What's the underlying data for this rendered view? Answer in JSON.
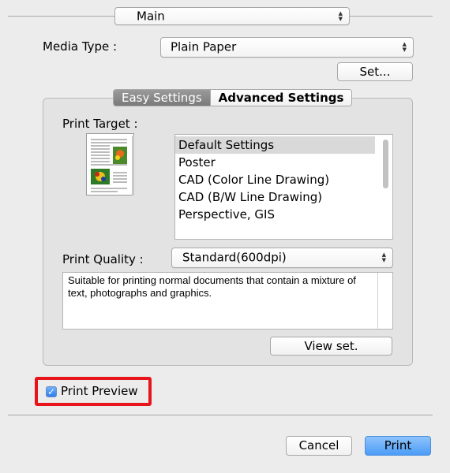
{
  "section_popup": {
    "value": "Main"
  },
  "media_type": {
    "label": "Media Type :",
    "value": "Plain Paper"
  },
  "set_button": {
    "label": "Set..."
  },
  "tabs": [
    {
      "label": "Easy Settings",
      "active": true
    },
    {
      "label": "Advanced Settings",
      "active": false
    }
  ],
  "print_target": {
    "label": "Print Target :",
    "items": [
      {
        "label": "Default Settings",
        "selected": true
      },
      {
        "label": "Poster",
        "selected": false
      },
      {
        "label": "CAD (Color Line Drawing)",
        "selected": false
      },
      {
        "label": "CAD (B/W Line Drawing)",
        "selected": false
      },
      {
        "label": "Perspective, GIS",
        "selected": false
      }
    ]
  },
  "print_quality": {
    "label": "Print Quality :",
    "value": "Standard(600dpi)"
  },
  "description": {
    "text": "Suitable for printing normal documents that contain a mixture of text, photographs and graphics."
  },
  "view_set_button": {
    "label": "View set."
  },
  "print_preview": {
    "label": "Print Preview",
    "checked": true,
    "highlight_color": "#e8141b"
  },
  "cancel_button": {
    "label": "Cancel"
  },
  "print_button": {
    "label": "Print"
  },
  "colors": {
    "window_bg": "#ececec",
    "accent_blue": "#4b9cf7",
    "highlight_red": "#e8141b"
  }
}
